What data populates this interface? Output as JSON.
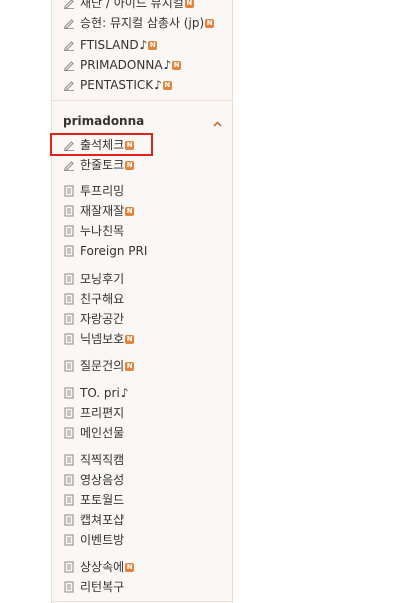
{
  "colors": {
    "badge": "#e4843a",
    "highlight": "#e2231a"
  },
  "top_group_a": [
    {
      "label": "재단 / 아이드 뮤지컬",
      "icon": "pencil-icon",
      "badge": "N",
      "note": ""
    },
    {
      "label": "승현: 뮤지컬 삼총사 (jp)",
      "icon": "pencil-icon",
      "badge": "N",
      "note": ""
    }
  ],
  "top_group_b": [
    {
      "label": "FTISLAND",
      "icon": "pencil-icon",
      "badge": "N",
      "note": "♪"
    },
    {
      "label": "PRIMADONNA",
      "icon": "pencil-icon",
      "badge": "N",
      "note": "♪"
    },
    {
      "label": "PENTASTICK",
      "icon": "pencil-icon",
      "badge": "N",
      "note": "♪"
    }
  ],
  "section": {
    "title": "primadonna",
    "toggle_icon": "chevron-up-icon"
  },
  "groups": [
    [
      {
        "label": "출석체크",
        "icon": "pencil-icon",
        "badge": "N",
        "note": "",
        "highlighted": true
      },
      {
        "label": "한줄토크",
        "icon": "pencil-icon",
        "badge": "N",
        "note": ""
      }
    ],
    [
      {
        "label": "투프리밍",
        "icon": "document-icon",
        "badge": "",
        "note": ""
      },
      {
        "label": "재잘재잘",
        "icon": "document-icon",
        "badge": "N",
        "note": ""
      },
      {
        "label": "누나친목",
        "icon": "document-icon",
        "badge": "",
        "note": ""
      },
      {
        "label": "Foreign PRI",
        "icon": "document-icon",
        "badge": "",
        "note": ""
      }
    ],
    [
      {
        "label": "모닝후기",
        "icon": "document-icon",
        "badge": "",
        "note": ""
      },
      {
        "label": "친구해요",
        "icon": "document-icon",
        "badge": "",
        "note": ""
      },
      {
        "label": "자랑공간",
        "icon": "document-icon",
        "badge": "",
        "note": ""
      },
      {
        "label": "닉넴보호",
        "icon": "document-icon",
        "badge": "N",
        "note": ""
      }
    ],
    [
      {
        "label": "질문건의",
        "icon": "document-icon",
        "badge": "N",
        "note": ""
      }
    ],
    [
      {
        "label": "TO. pri",
        "icon": "document-icon",
        "badge": "",
        "note": "♪"
      },
      {
        "label": "프리편지",
        "icon": "document-icon",
        "badge": "",
        "note": ""
      },
      {
        "label": "메인선물",
        "icon": "document-icon",
        "badge": "",
        "note": ""
      }
    ],
    [
      {
        "label": "직찍직캠",
        "icon": "document-icon",
        "badge": "",
        "note": ""
      },
      {
        "label": "영상음성",
        "icon": "document-icon",
        "badge": "",
        "note": ""
      },
      {
        "label": "포토월드",
        "icon": "document-icon",
        "badge": "",
        "note": ""
      },
      {
        "label": "캡쳐포샵",
        "icon": "document-icon",
        "badge": "",
        "note": ""
      },
      {
        "label": "이벤트방",
        "icon": "document-icon",
        "badge": "",
        "note": ""
      }
    ],
    [
      {
        "label": "상상속에",
        "icon": "document-icon",
        "badge": "N",
        "note": ""
      },
      {
        "label": "리턴복구",
        "icon": "document-icon",
        "badge": "",
        "note": ""
      }
    ]
  ]
}
